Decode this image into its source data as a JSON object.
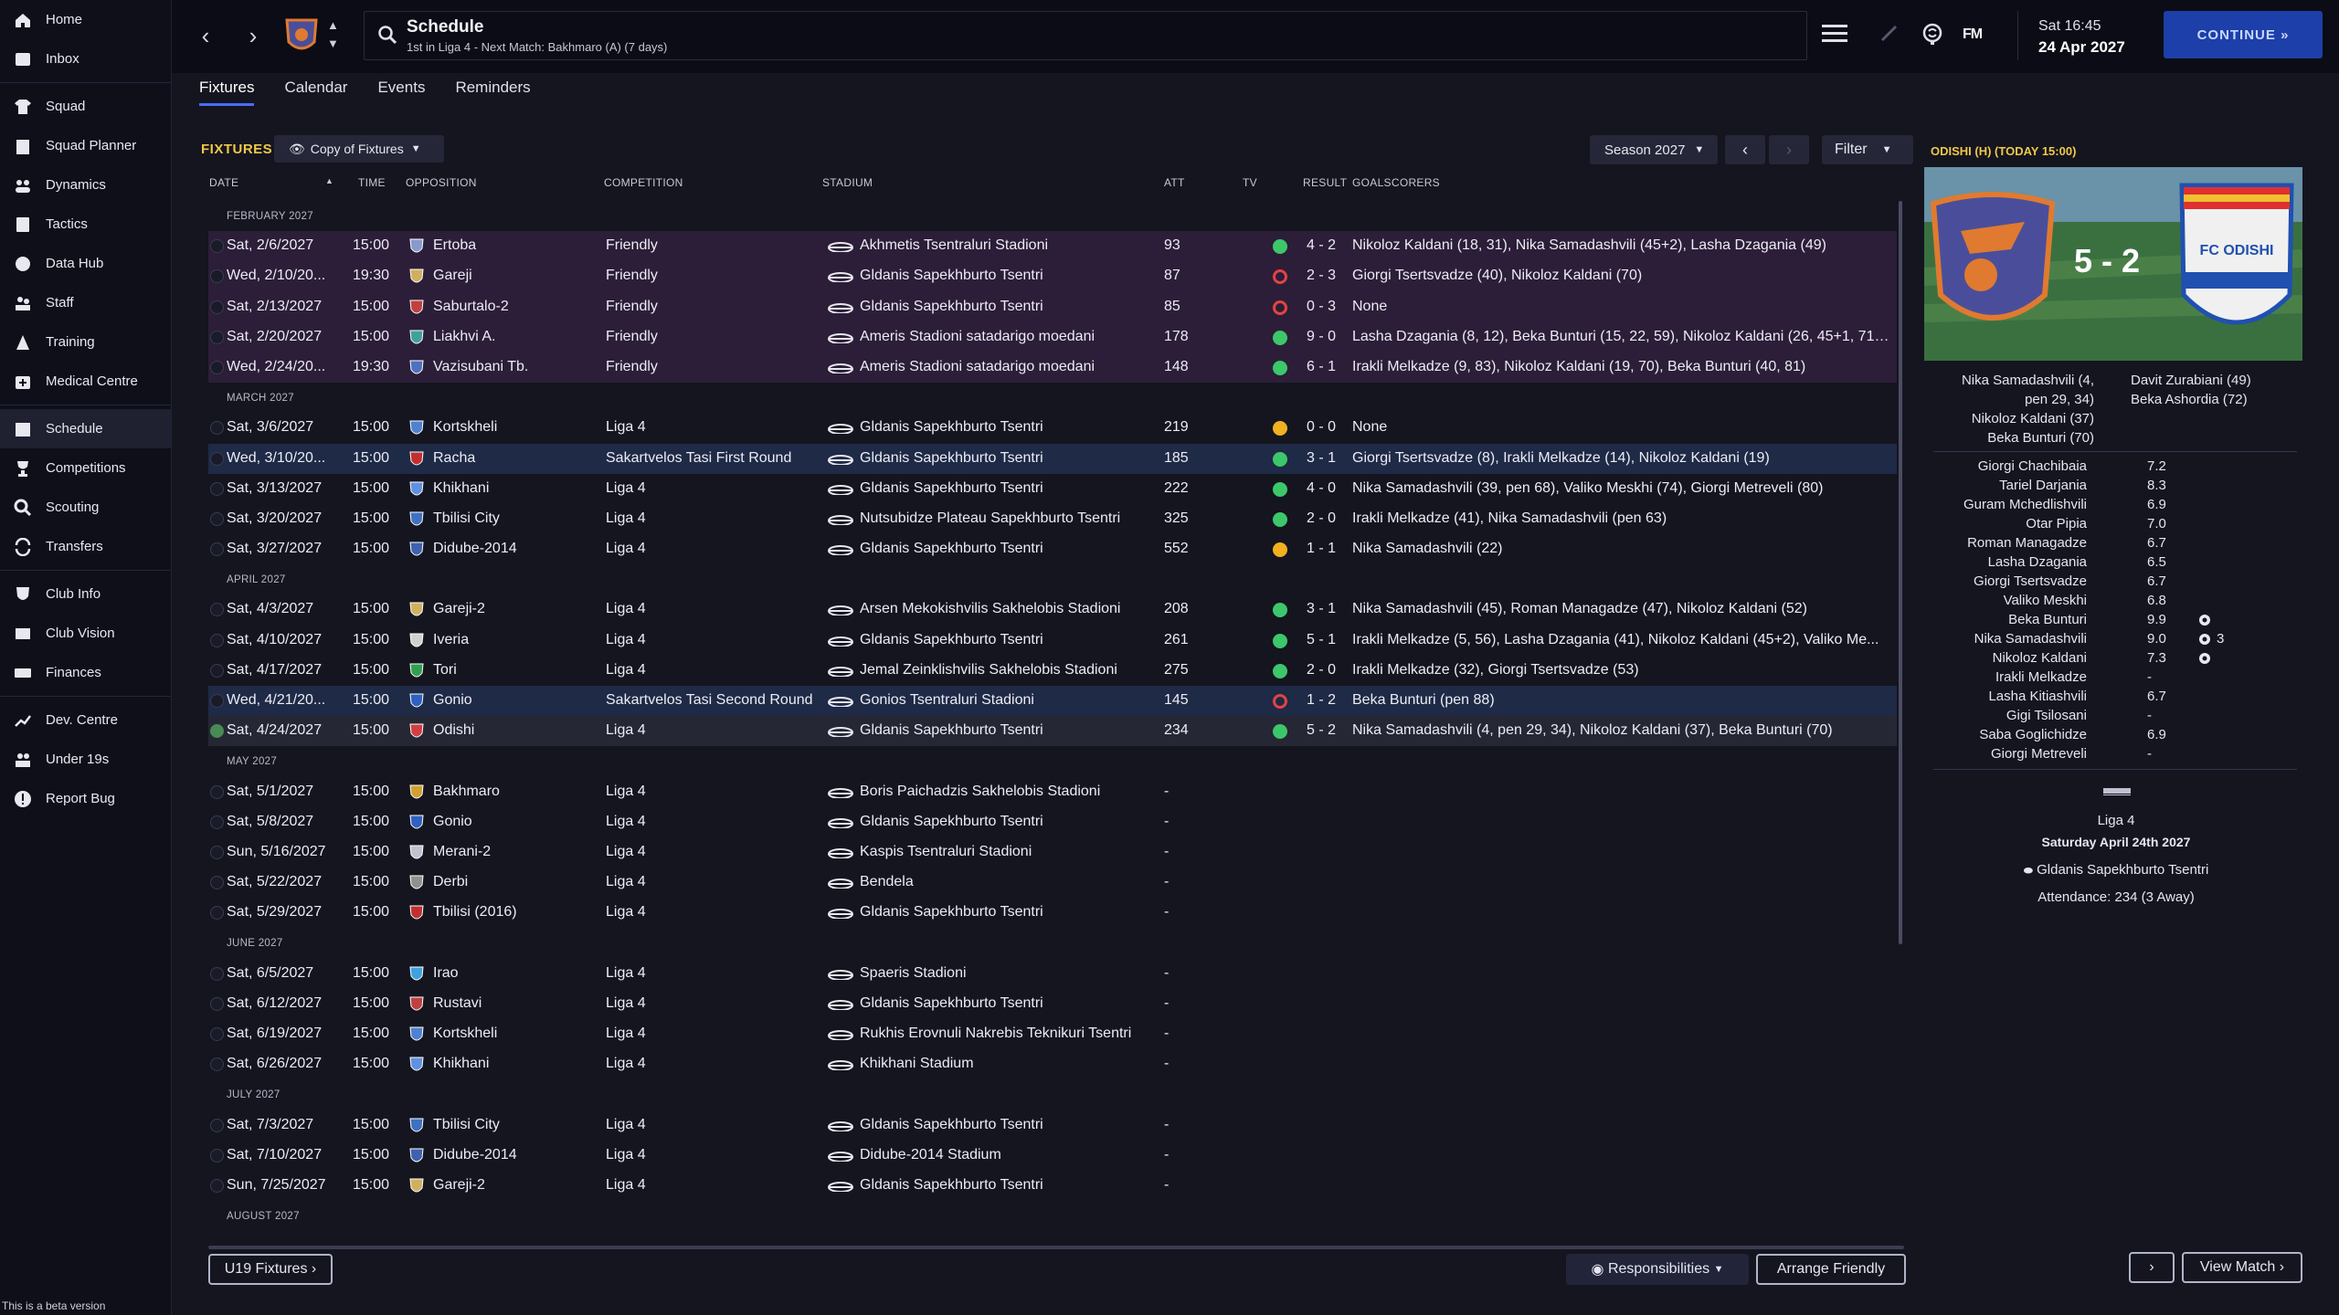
{
  "sidebar": {
    "items": [
      {
        "label": "Home",
        "icon": "home-icon"
      },
      {
        "label": "Inbox",
        "icon": "inbox-icon"
      },
      {
        "label": "Squad",
        "icon": "shirt-icon"
      },
      {
        "label": "Squad Planner",
        "icon": "clipboard-icon"
      },
      {
        "label": "Dynamics",
        "icon": "people-icon"
      },
      {
        "label": "Tactics",
        "icon": "board-icon"
      },
      {
        "label": "Data Hub",
        "icon": "chart-icon"
      },
      {
        "label": "Staff",
        "icon": "staff-icon"
      },
      {
        "label": "Training",
        "icon": "cone-icon"
      },
      {
        "label": "Medical Centre",
        "icon": "medical-icon"
      },
      {
        "label": "Schedule",
        "icon": "calendar-icon"
      },
      {
        "label": "Competitions",
        "icon": "trophy-icon"
      },
      {
        "label": "Scouting",
        "icon": "search-icon"
      },
      {
        "label": "Transfers",
        "icon": "transfer-icon"
      },
      {
        "label": "Club Info",
        "icon": "shield-icon"
      },
      {
        "label": "Club Vision",
        "icon": "vision-icon"
      },
      {
        "label": "Finances",
        "icon": "money-icon"
      },
      {
        "label": "Dev. Centre",
        "icon": "growth-icon"
      },
      {
        "label": "Under 19s",
        "icon": "youth-icon"
      },
      {
        "label": "Report Bug",
        "icon": "alert-icon"
      }
    ],
    "beta": "This is a beta version"
  },
  "header": {
    "title": "Schedule",
    "subtitle": "1st in Liga 4 - Next Match: Bakhmaro (A) (7 days)",
    "fm": "FM",
    "time": "Sat 16:45",
    "date": "24 Apr 2027",
    "continue": "CONTINUE"
  },
  "tabs": [
    "Fixtures",
    "Calendar",
    "Events",
    "Reminders"
  ],
  "fixtures": {
    "label": "FIXTURES",
    "view": "Copy of Fixtures",
    "season": "Season 2027",
    "filter": "Filter",
    "columns": {
      "date": "DATE",
      "time": "TIME",
      "opposition": "OPPOSITION",
      "competition": "COMPETITION",
      "stadium": "STADIUM",
      "att": "ATT",
      "tv": "TV",
      "result": "RESULT",
      "goalscorers": "GOALSCORERS"
    },
    "groups": [
      {
        "month": "FEBRUARY 2027",
        "rows": [
          {
            "date": "Sat, 2/6/2027",
            "time": "15:00",
            "opp": "Ertoba",
            "comp": "Friendly",
            "stad": "Akhmetis Tsentraluri Stadioni",
            "att": "93",
            "res": "4 - 2",
            "out": "w",
            "gs": "Nikoloz Kaldani (18, 31), Nika Samadashvili (45+2), Lasha Dzagania (49)",
            "type": "friendly",
            "badge": "#8899cc"
          },
          {
            "date": "Wed, 2/10/20...",
            "time": "19:30",
            "opp": "Gareji",
            "comp": "Friendly",
            "stad": "Gldanis Sapekhburto Tsentri",
            "att": "87",
            "res": "2 - 3",
            "out": "l",
            "gs": "Giorgi Tsertsvadze (40), Nikoloz Kaldani (70)",
            "type": "friendly",
            "badge": "#d0b060"
          },
          {
            "date": "Sat, 2/13/2027",
            "time": "15:00",
            "opp": "Saburtalo-2",
            "comp": "Friendly",
            "stad": "Gldanis Sapekhburto Tsentri",
            "att": "85",
            "res": "0 - 3",
            "out": "l",
            "gs": "None",
            "type": "friendly",
            "badge": "#c04040"
          },
          {
            "date": "Sat, 2/20/2027",
            "time": "15:00",
            "opp": "Liakhvi A.",
            "comp": "Friendly",
            "stad": "Ameris Stadioni satadarigo moedani",
            "att": "178",
            "res": "9 - 0",
            "out": "w",
            "gs": "Lasha Dzagania (8, 12), Beka Bunturi (15, 22, 59), Nikoloz Kaldani (26, 45+1, 71),...",
            "type": "friendly",
            "badge": "#40a0a0"
          },
          {
            "date": "Wed, 2/24/20...",
            "time": "19:30",
            "opp": "Vazisubani Tb.",
            "comp": "Friendly",
            "stad": "Ameris Stadioni satadarigo moedani",
            "att": "148",
            "res": "6 - 1",
            "out": "w",
            "gs": "Irakli Melkadze (9, 83), Nikoloz Kaldani (19, 70), Beka Bunturi (40, 81)",
            "type": "friendly",
            "badge": "#5070c0"
          }
        ]
      },
      {
        "month": "MARCH 2027",
        "rows": [
          {
            "date": "Sat, 3/6/2027",
            "time": "15:00",
            "opp": "Kortskheli",
            "comp": "Liga 4",
            "stad": "Gldanis Sapekhburto Tsentri",
            "att": "219",
            "res": "0 - 0",
            "out": "d",
            "gs": "None",
            "type": "",
            "badge": "#5080d0"
          },
          {
            "date": "Wed, 3/10/20...",
            "time": "15:00",
            "opp": "Racha",
            "comp": "Sakartvelos Tasi First Round",
            "stad": "Gldanis Sapekhburto Tsentri",
            "att": "185",
            "res": "3 - 1",
            "out": "w",
            "gs": "Giorgi Tsertsvadze (8), Irakli Melkadze (14), Nikoloz Kaldani (19)",
            "type": "hl",
            "badge": "#c03030"
          },
          {
            "date": "Sat, 3/13/2027",
            "time": "15:00",
            "opp": "Khikhani",
            "comp": "Liga 4",
            "stad": "Gldanis Sapekhburto Tsentri",
            "att": "222",
            "res": "4 - 0",
            "out": "w",
            "gs": "Nika Samadashvili (39, pen 68), Valiko Meskhi (74), Giorgi Metreveli (80)",
            "type": "",
            "badge": "#6090e0"
          },
          {
            "date": "Sat, 3/20/2027",
            "time": "15:00",
            "opp": "Tbilisi City",
            "comp": "Liga 4",
            "stad": "Nutsubidze Plateau Sapekhburto Tsentri",
            "att": "325",
            "res": "2 - 0",
            "out": "w",
            "gs": "Irakli Melkadze (41), Nika Samadashvili (pen 63)",
            "type": "",
            "badge": "#4070c0"
          },
          {
            "date": "Sat, 3/27/2027",
            "time": "15:00",
            "opp": "Didube-2014",
            "comp": "Liga 4",
            "stad": "Gldanis Sapekhburto Tsentri",
            "att": "552",
            "res": "1 - 1",
            "out": "d",
            "gs": "Nika Samadashvili (22)",
            "type": "",
            "badge": "#4060b0"
          }
        ]
      },
      {
        "month": "APRIL 2027",
        "rows": [
          {
            "date": "Sat, 4/3/2027",
            "time": "15:00",
            "opp": "Gareji-2",
            "comp": "Liga 4",
            "stad": "Arsen Mekokishvilis Sakhelobis Stadioni",
            "att": "208",
            "res": "3 - 1",
            "out": "w",
            "gs": "Nika Samadashvili (45), Roman Managadze (47), Nikoloz Kaldani (52)",
            "type": "",
            "badge": "#d0b060"
          },
          {
            "date": "Sat, 4/10/2027",
            "time": "15:00",
            "opp": "Iveria",
            "comp": "Liga 4",
            "stad": "Gldanis Sapekhburto Tsentri",
            "att": "261",
            "res": "5 - 1",
            "out": "w",
            "gs": "Irakli Melkadze (5, 56), Lasha Dzagania (41), Nikoloz Kaldani (45+2), Valiko Me...",
            "type": "",
            "badge": "#d0d0d0"
          },
          {
            "date": "Sat, 4/17/2027",
            "time": "15:00",
            "opp": "Tori",
            "comp": "Liga 4",
            "stad": "Jemal Zeinklishvilis Sakhelobis Stadioni",
            "att": "275",
            "res": "2 - 0",
            "out": "w",
            "gs": "Irakli Melkadze (32), Giorgi Tsertsvadze (53)",
            "type": "",
            "badge": "#30a050"
          },
          {
            "date": "Wed, 4/21/20...",
            "time": "15:00",
            "opp": "Gonio",
            "comp": "Sakartvelos Tasi Second Round",
            "stad": "Gonios Tsentraluri Stadioni",
            "att": "145",
            "res": "1 - 2",
            "out": "l",
            "gs": "Beka Bunturi (pen 88)",
            "type": "hl",
            "badge": "#3060c0"
          },
          {
            "date": "Sat, 4/24/2027",
            "time": "15:00",
            "opp": "Odishi",
            "comp": "Liga 4",
            "stad": "Gldanis Sapekhburto Tsentri",
            "att": "234",
            "res": "5 - 2",
            "out": "w",
            "gs": "Nika Samadashvili (4, pen 29, 34), Nikoloz Kaldani (37), Beka Bunturi (70)",
            "type": "cur",
            "badge": "#d04040",
            "done": true
          }
        ]
      },
      {
        "month": "MAY 2027",
        "rows": [
          {
            "date": "Sat, 5/1/2027",
            "time": "15:00",
            "opp": "Bakhmaro",
            "comp": "Liga 4",
            "stad": "Boris Paichadzis Sakhelobis Stadioni",
            "att": "-",
            "res": "",
            "out": "",
            "gs": "",
            "type": "",
            "badge": "#d0a030"
          },
          {
            "date": "Sat, 5/8/2027",
            "time": "15:00",
            "opp": "Gonio",
            "comp": "Liga 4",
            "stad": "Gldanis Sapekhburto Tsentri",
            "att": "-",
            "res": "",
            "out": "",
            "gs": "",
            "type": "",
            "badge": "#3060c0"
          },
          {
            "date": "Sun, 5/16/2027",
            "time": "15:00",
            "opp": "Merani-2",
            "comp": "Liga 4",
            "stad": "Kaspis Tsentraluri Stadioni",
            "att": "-",
            "res": "",
            "out": "",
            "gs": "",
            "type": "",
            "badge": "#c0c0d0"
          },
          {
            "date": "Sat, 5/22/2027",
            "time": "15:00",
            "opp": "Derbi",
            "comp": "Liga 4",
            "stad": "Bendela",
            "att": "-",
            "res": "",
            "out": "",
            "gs": "",
            "type": "",
            "badge": "#909090"
          },
          {
            "date": "Sat, 5/29/2027",
            "time": "15:00",
            "opp": "Tbilisi (2016)",
            "comp": "Liga 4",
            "stad": "Gldanis Sapekhburto Tsentri",
            "att": "-",
            "res": "",
            "out": "",
            "gs": "",
            "type": "",
            "badge": "#c03030"
          }
        ]
      },
      {
        "month": "JUNE 2027",
        "rows": [
          {
            "date": "Sat, 6/5/2027",
            "time": "15:00",
            "opp": "Irao",
            "comp": "Liga 4",
            "stad": "Spaeris Stadioni",
            "att": "-",
            "res": "",
            "out": "",
            "gs": "",
            "type": "",
            "badge": "#40a0e0"
          },
          {
            "date": "Sat, 6/12/2027",
            "time": "15:00",
            "opp": "Rustavi",
            "comp": "Liga 4",
            "stad": "Gldanis Sapekhburto Tsentri",
            "att": "-",
            "res": "",
            "out": "",
            "gs": "",
            "type": "",
            "badge": "#c04040"
          },
          {
            "date": "Sat, 6/19/2027",
            "time": "15:00",
            "opp": "Kortskheli",
            "comp": "Liga 4",
            "stad": "Rukhis Erovnuli Nakrebis Teknikuri Tsentri",
            "att": "-",
            "res": "",
            "out": "",
            "gs": "",
            "type": "",
            "badge": "#5080d0"
          },
          {
            "date": "Sat, 6/26/2027",
            "time": "15:00",
            "opp": "Khikhani",
            "comp": "Liga 4",
            "stad": "Khikhani Stadium",
            "att": "-",
            "res": "",
            "out": "",
            "gs": "",
            "type": "",
            "badge": "#6090e0"
          }
        ]
      },
      {
        "month": "JULY 2027",
        "rows": [
          {
            "date": "Sat, 7/3/2027",
            "time": "15:00",
            "opp": "Tbilisi City",
            "comp": "Liga 4",
            "stad": "Gldanis Sapekhburto Tsentri",
            "att": "-",
            "res": "",
            "out": "",
            "gs": "",
            "type": "",
            "badge": "#4070c0"
          },
          {
            "date": "Sat, 7/10/2027",
            "time": "15:00",
            "opp": "Didube-2014",
            "comp": "Liga 4",
            "stad": "Didube-2014 Stadium",
            "att": "-",
            "res": "",
            "out": "",
            "gs": "",
            "type": "",
            "badge": "#4060b0"
          },
          {
            "date": "Sun, 7/25/2027",
            "time": "15:00",
            "opp": "Gareji-2",
            "comp": "Liga 4",
            "stad": "Gldanis Sapekhburto Tsentri",
            "att": "-",
            "res": "",
            "out": "",
            "gs": "",
            "type": "",
            "badge": "#d0b060"
          }
        ]
      },
      {
        "month": "AUGUST 2027",
        "rows": []
      }
    ]
  },
  "buttons": {
    "u19": "U19 Fixtures",
    "responsibilities": "Responsibilities",
    "arrange": "Arrange Friendly",
    "view_match": "View Match"
  },
  "panel": {
    "title": "ODISHI (H) (TODAY 15:00)",
    "score": "5 - 2",
    "home_scorers": [
      "Nika Samadashvili (4,",
      "pen 29, 34)",
      "Nikoloz Kaldani (37)",
      "Beka Bunturi (70)"
    ],
    "away_scorers": [
      "Davit Zurabiani (49)",
      "Beka Ashordia (72)"
    ],
    "ratings": [
      {
        "name": "Giorgi Chachibaia",
        "val": "7.2"
      },
      {
        "name": "Tariel Darjania",
        "val": "8.3"
      },
      {
        "name": "Guram Mchedlishvili",
        "val": "6.9"
      },
      {
        "name": "Otar Pipia",
        "val": "7.0"
      },
      {
        "name": "Roman Managadze",
        "val": "6.7"
      },
      {
        "name": "Lasha Dzagania",
        "val": "6.5"
      },
      {
        "name": "Giorgi Tsertsvadze",
        "val": "6.7"
      },
      {
        "name": "Valiko Meskhi",
        "val": "6.8"
      },
      {
        "name": "Beka Bunturi",
        "val": "9.9",
        "goal": true
      },
      {
        "name": "Nika Samadashvili",
        "val": "9.0",
        "goal": true,
        "goals": "3"
      },
      {
        "name": "Nikoloz Kaldani",
        "val": "7.3",
        "goal": true
      },
      {
        "name": "Irakli Melkadze",
        "val": "-"
      },
      {
        "name": "Lasha Kitiashvili",
        "val": "6.7"
      },
      {
        "name": "Gigi Tsilosani",
        "val": "-"
      },
      {
        "name": "Saba Goglichidze",
        "val": "6.9"
      },
      {
        "name": "Giorgi Metreveli",
        "val": "-"
      }
    ],
    "competition": "Liga 4",
    "date": "Saturday April 24th 2027",
    "stadium": "Gldanis Sapekhburto Tsentri",
    "attendance": "Attendance: 234 (3 Away)"
  }
}
